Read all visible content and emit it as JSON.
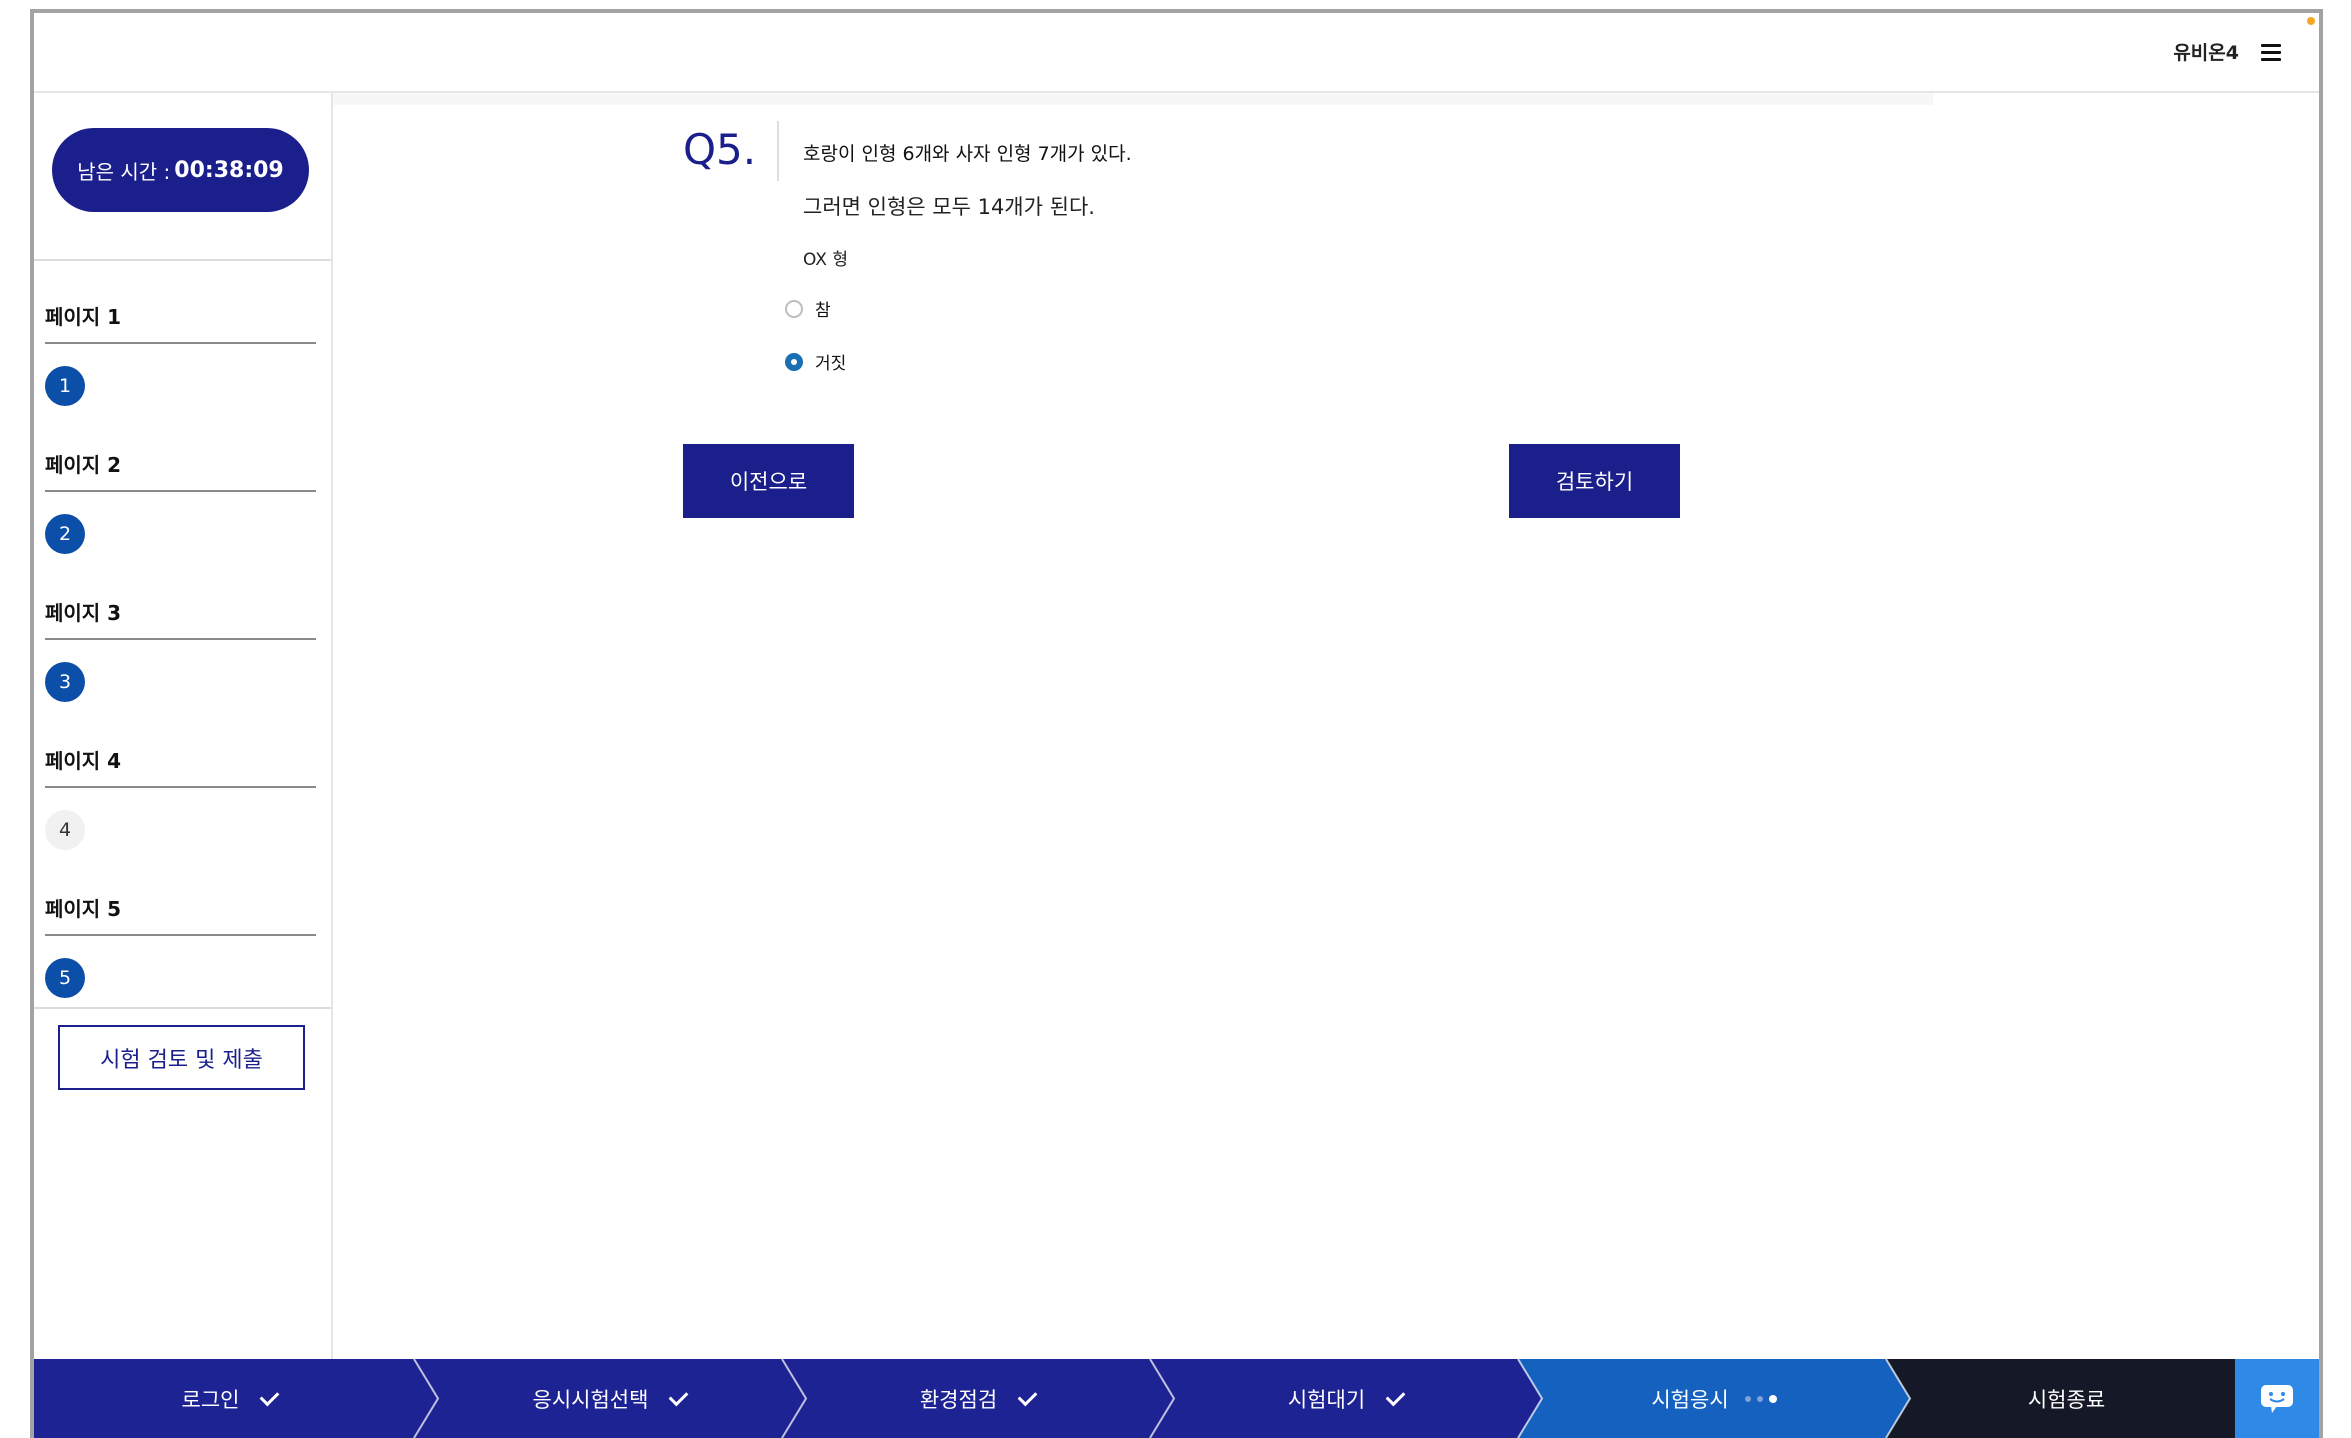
{
  "header": {
    "user_name": "유비온4"
  },
  "sidebar": {
    "timer_label": "남은 시간 :",
    "timer_value": "00:38:09",
    "pages": [
      {
        "title": "페이지 1",
        "num": "1",
        "answered": true
      },
      {
        "title": "페이지 2",
        "num": "2",
        "answered": true
      },
      {
        "title": "페이지 3",
        "num": "3",
        "answered": true
      },
      {
        "title": "페이지 4",
        "num": "4",
        "answered": false
      },
      {
        "title": "페이지 5",
        "num": "5",
        "answered": true
      }
    ],
    "review_submit_label": "시험 검토 및 제출"
  },
  "question": {
    "label": "Q5.",
    "text_line1": "호랑이 인형 6개와 사자 인형 7개가 있다.",
    "text_line2": "그러면 인형은 모두 14개가 된다.",
    "type": "OX 형",
    "options": [
      {
        "label": "참",
        "selected": false
      },
      {
        "label": "거짓",
        "selected": true
      }
    ],
    "prev_button": "이전으로",
    "review_button": "검토하기"
  },
  "progress_steps": [
    {
      "label": "로그인",
      "status": "done"
    },
    {
      "label": "응시시험선택",
      "status": "done"
    },
    {
      "label": "환경점검",
      "status": "done"
    },
    {
      "label": "시험대기",
      "status": "done"
    },
    {
      "label": "시험응시",
      "status": "current"
    },
    {
      "label": "시험종료",
      "status": "pending"
    }
  ],
  "colors": {
    "primary": "#1b1f8c",
    "answered": "#0b4fa8",
    "step_done": "#1e2393",
    "step_current": "#1461c0",
    "step_pending": "#151826",
    "chat": "#2e8ae6"
  }
}
